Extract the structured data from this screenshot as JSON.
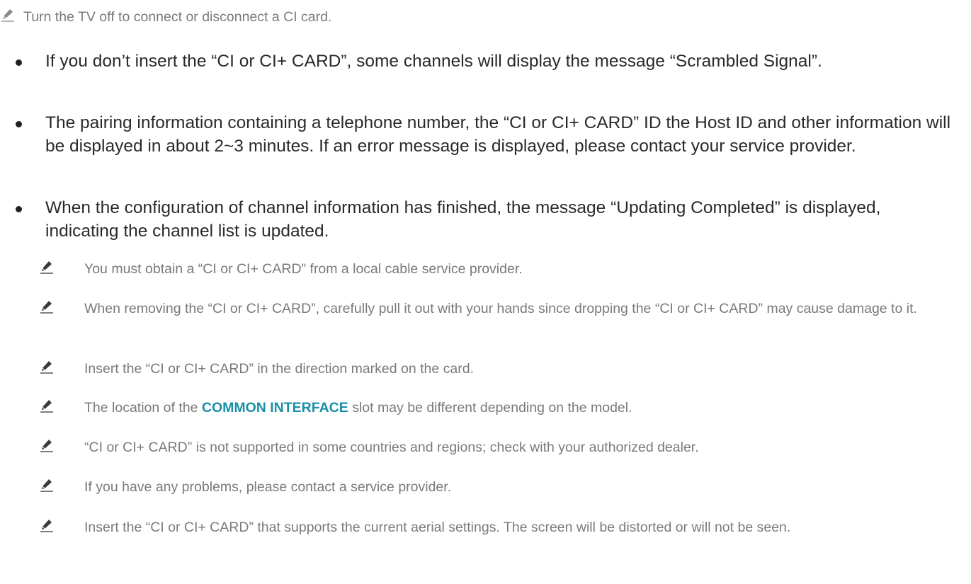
{
  "top_note": {
    "icon": "pencil-note-icon",
    "text": "Turn the TV off to connect or disconnect a CI card."
  },
  "bullets": [
    {
      "text": "If you don’t insert the “CI or CI+ CARD”, some channels will display the message “Scrambled Signal”."
    },
    {
      "text": "The pairing information containing a telephone number, the “CI or CI+ CARD” ID the Host ID and other information will be displayed in about 2~3 minutes. If an error message is displayed, please contact your service provider."
    },
    {
      "text": "When the configuration of channel information has finished, the message “Updating Completed” is displayed, indicating the channel list is updated."
    }
  ],
  "notes": [
    {
      "text": "You must obtain a “CI or CI+ CARD” from a local cable service provider."
    },
    {
      "text": "When removing the “CI or CI+ CARD”, carefully pull it out with your hands since dropping the “CI or CI+ CARD” may cause damage to it."
    },
    {
      "text": "Insert the “CI or CI+ CARD” in the direction marked on the card."
    },
    {
      "text_before": "The location of the ",
      "accent": "COMMON INTERFACE",
      "text_after": " slot may be different depending on the model."
    },
    {
      "text": "“CI or CI+ CARD” is not supported in some countries and regions; check with your authorized dealer."
    },
    {
      "text": "If you have any problems, please contact a service provider."
    },
    {
      "text": "Insert the “CI or CI+ CARD” that supports the current aerial settings. The screen will be distorted or will not be seen."
    }
  ],
  "colors": {
    "note_text": "#7a7a7a",
    "body_text": "#2a2a2a",
    "accent": "#1a8fa8"
  }
}
